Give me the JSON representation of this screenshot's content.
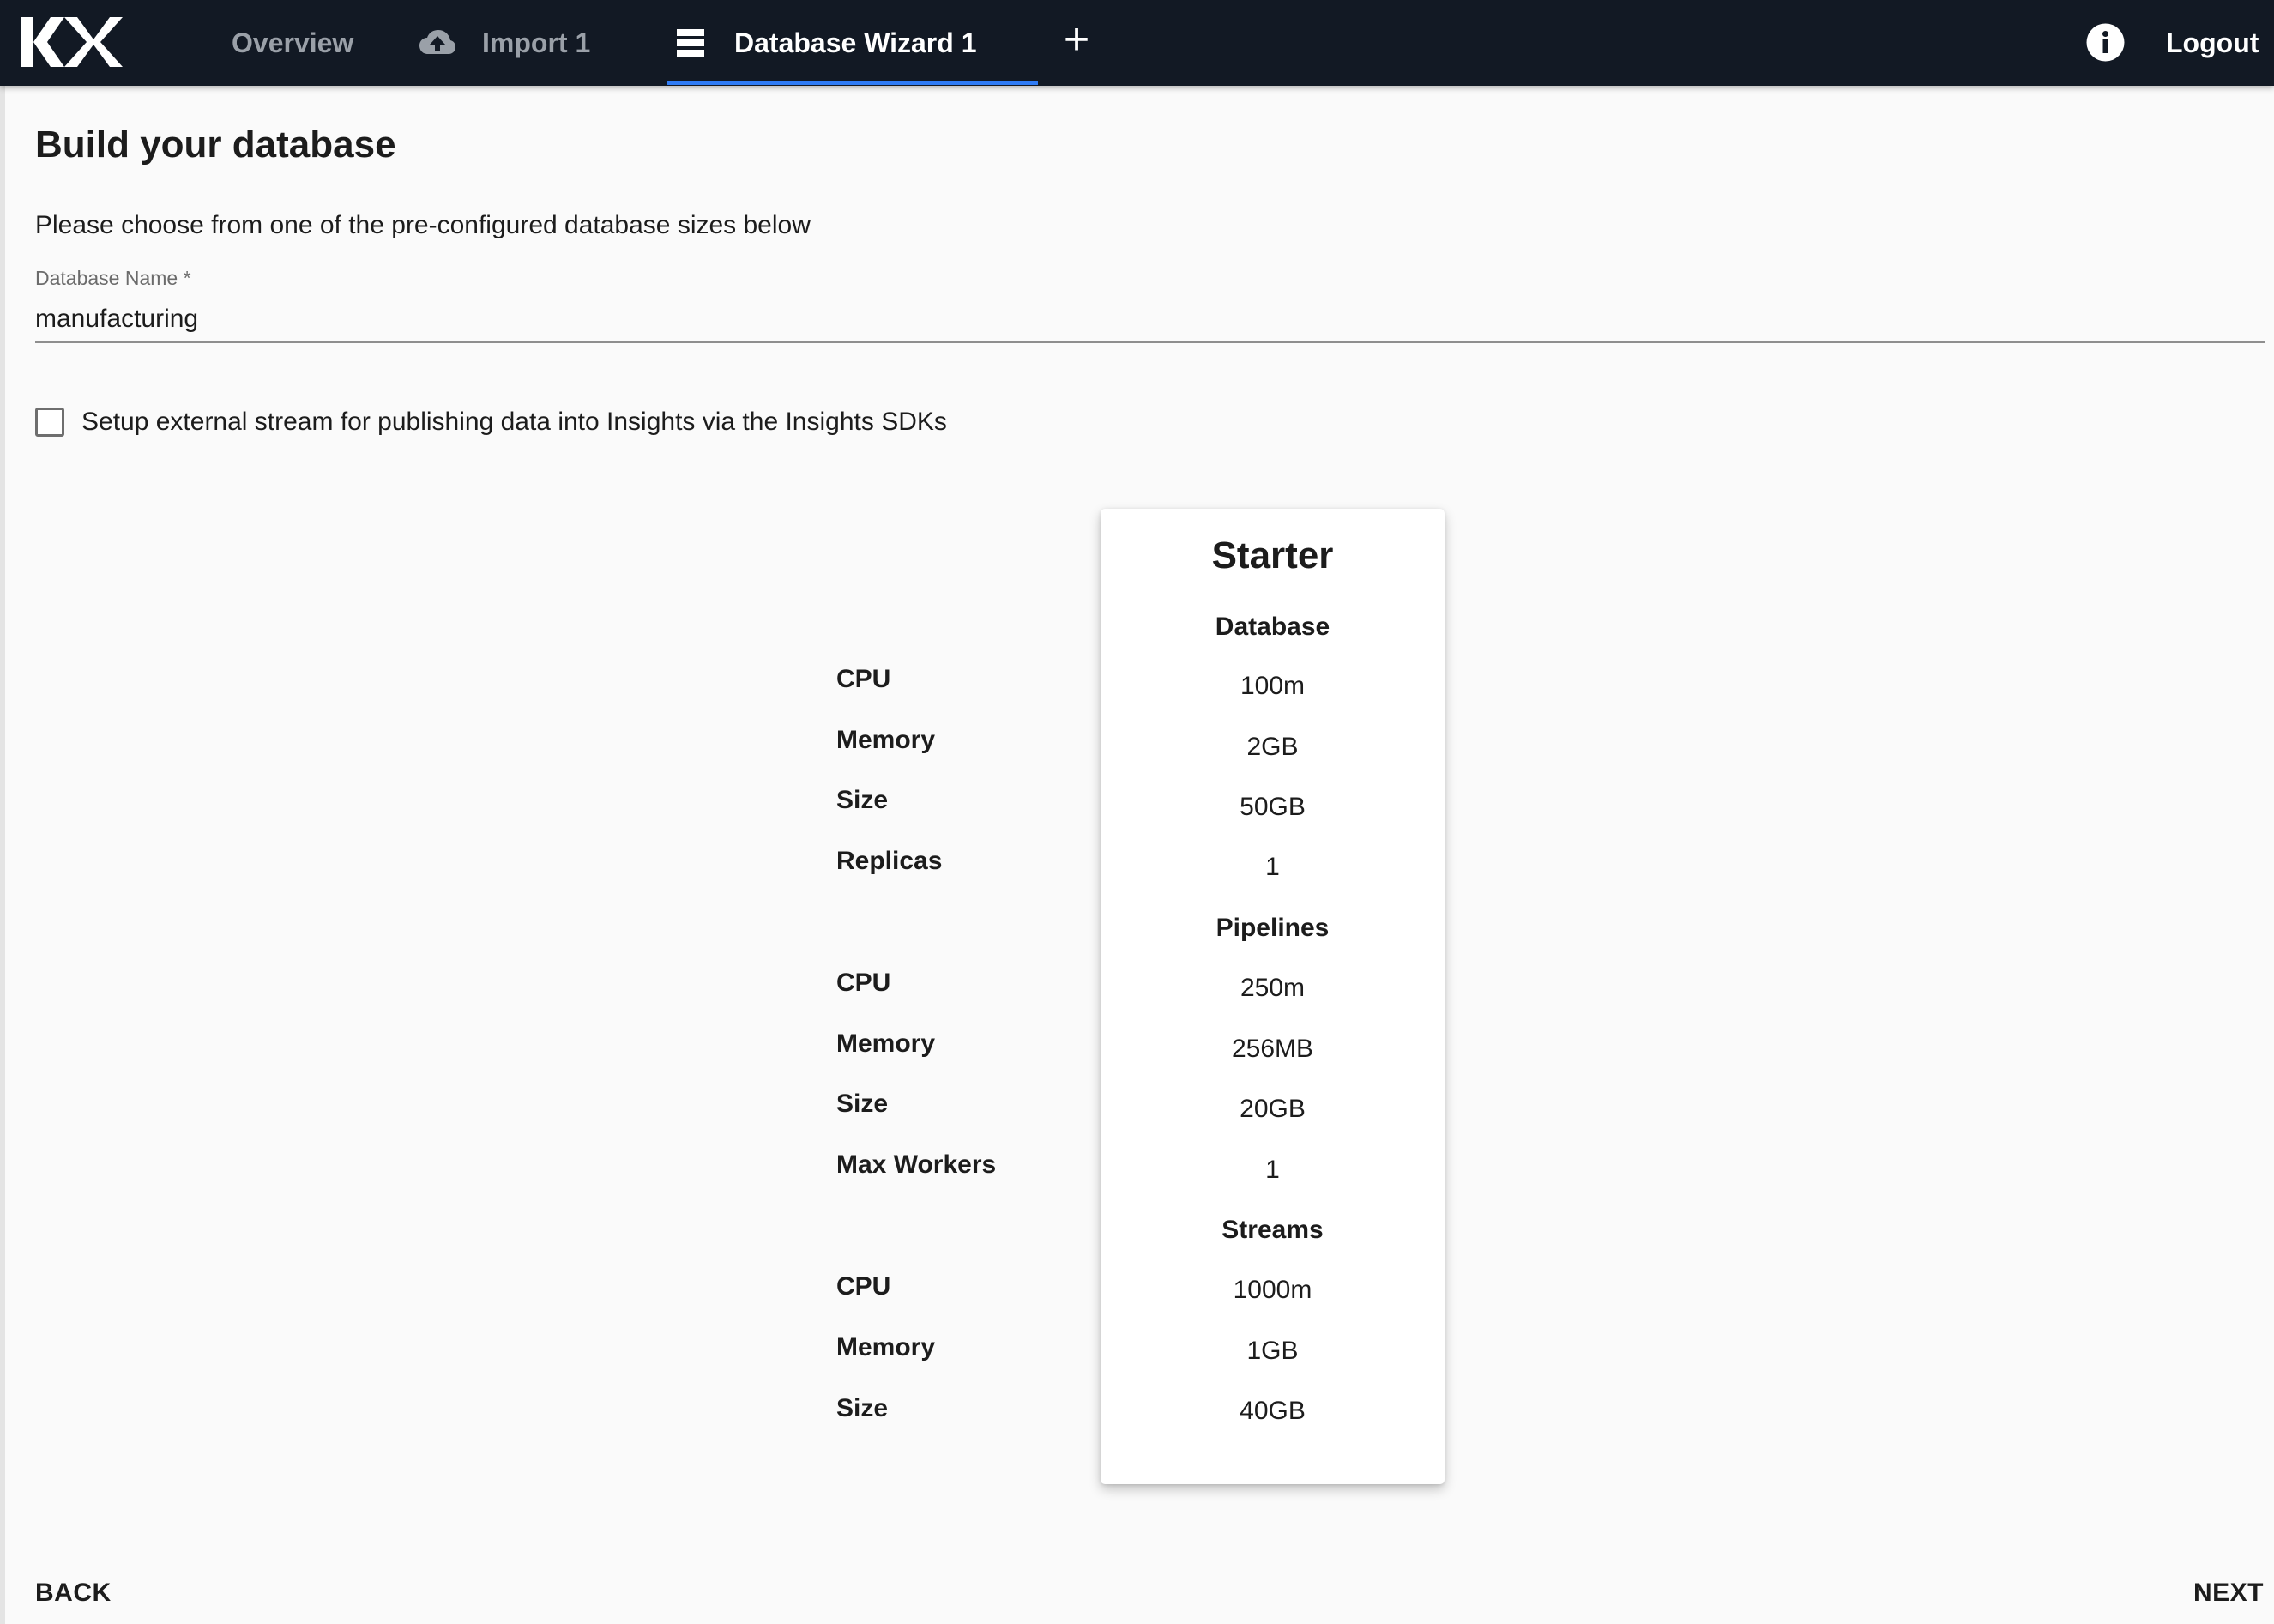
{
  "app": {
    "logo_text": "KX"
  },
  "nav": {
    "tabs": [
      {
        "label": "Overview",
        "icon": "",
        "active": false
      },
      {
        "label": "Import 1",
        "icon": "cloud-upload-icon",
        "active": false
      },
      {
        "label": "Database Wizard 1",
        "icon": "database-icon",
        "active": true
      }
    ],
    "add_tab_label": "+",
    "info_icon": "info-icon",
    "logout_label": "Logout"
  },
  "page": {
    "title": "Build your database",
    "intro": "Please choose from one of the pre-configured database sizes below"
  },
  "form": {
    "database_name": {
      "label": "Database Name *",
      "value": "manufacturing"
    },
    "external_stream": {
      "label": "Setup external stream for publishing data into Insights via the Insights SDKs",
      "checked": false
    }
  },
  "plan": {
    "name": "Starter",
    "sections": [
      {
        "title": "Database",
        "rows": [
          {
            "label": "CPU",
            "value": "100m"
          },
          {
            "label": "Memory",
            "value": "2GB"
          },
          {
            "label": "Size",
            "value": "50GB"
          },
          {
            "label": "Replicas",
            "value": "1"
          }
        ]
      },
      {
        "title": "Pipelines",
        "rows": [
          {
            "label": "CPU",
            "value": "250m"
          },
          {
            "label": "Memory",
            "value": "256MB"
          },
          {
            "label": "Size",
            "value": "20GB"
          },
          {
            "label": "Max Workers",
            "value": "1"
          }
        ]
      },
      {
        "title": "Streams",
        "rows": [
          {
            "label": "CPU",
            "value": "1000m"
          },
          {
            "label": "Memory",
            "value": "1GB"
          },
          {
            "label": "Size",
            "value": "40GB"
          }
        ]
      }
    ]
  },
  "footer": {
    "back_label": "BACK",
    "next_label": "NEXT"
  },
  "colors": {
    "topbar": "#121924",
    "active_tab_underline": "#2f7cf6",
    "page_background": "#fafafa",
    "card_background": "#ffffff"
  }
}
